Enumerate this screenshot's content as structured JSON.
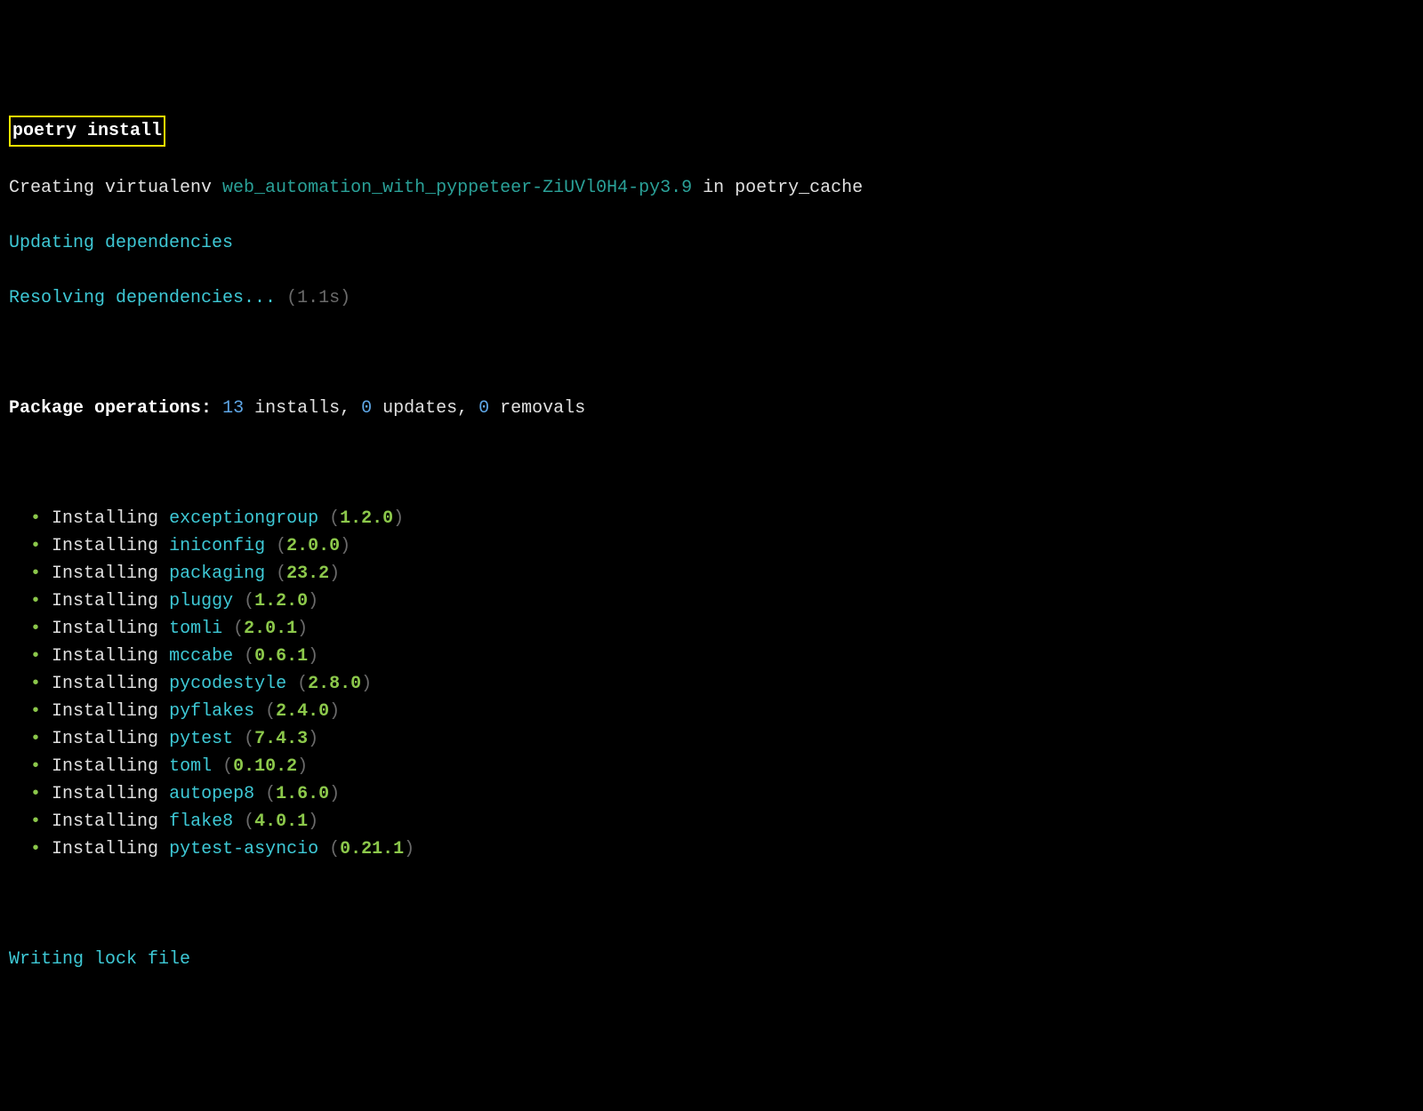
{
  "command": "poetry install",
  "create_line": {
    "prefix": "Creating virtualenv ",
    "venv": "web_automation_with_pyppeteer-ZiUVl0H4-py3.9",
    "suffix": " in poetry_cache"
  },
  "updating": "Updating dependencies",
  "resolving": {
    "label": "Resolving dependencies...",
    "time": "(1.1s)"
  },
  "ops_header": {
    "label": "Package operations:",
    "installs_n": "13",
    "installs_w": " installs, ",
    "updates_n": "0",
    "updates_w": " updates, ",
    "removals_n": "0",
    "removals_w": " removals"
  },
  "installs": [
    {
      "name": "exceptiongroup",
      "ver": "1.2.0"
    },
    {
      "name": "iniconfig",
      "ver": "2.0.0"
    },
    {
      "name": "packaging",
      "ver": "23.2"
    },
    {
      "name": "pluggy",
      "ver": "1.2.0"
    },
    {
      "name": "tomli",
      "ver": "2.0.1"
    },
    {
      "name": "mccabe",
      "ver": "0.6.1"
    },
    {
      "name": "pycodestyle",
      "ver": "2.8.0"
    },
    {
      "name": "pyflakes",
      "ver": "2.4.0"
    },
    {
      "name": "pytest",
      "ver": "7.4.3"
    },
    {
      "name": "toml",
      "ver": "0.10.2"
    },
    {
      "name": "autopep8",
      "ver": "1.6.0"
    },
    {
      "name": "flake8",
      "ver": "4.0.1"
    },
    {
      "name": "pytest-asyncio",
      "ver": "0.21.1"
    }
  ],
  "writing": "Writing lock file"
}
